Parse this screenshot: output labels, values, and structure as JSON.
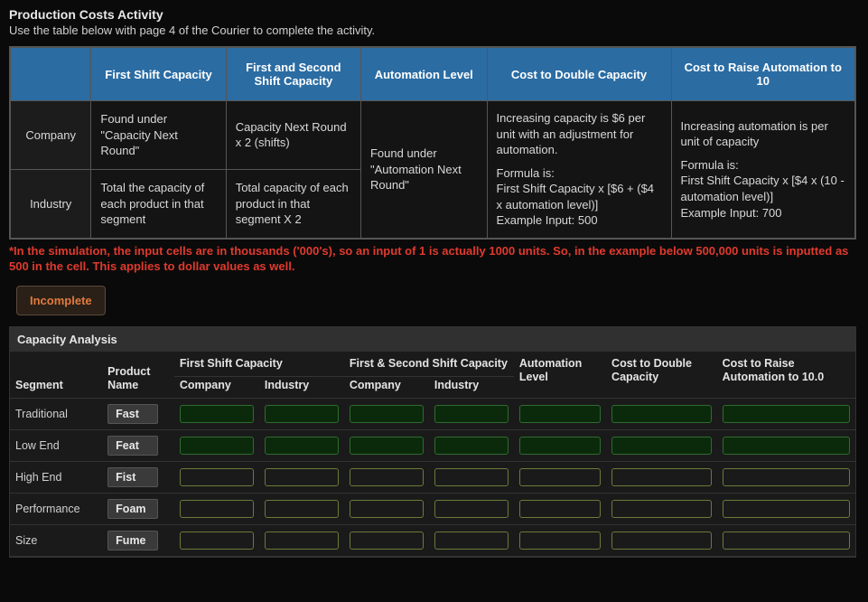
{
  "page": {
    "title": "Production Costs Activity",
    "subtitle": "Use the table below with page 4 of the Courier to complete the activity."
  },
  "refTable": {
    "headers": [
      "First Shift Capacity",
      "First and Second Shift Capacity",
      "Automation Level",
      "Cost to Double Capacity",
      "Cost to Raise Automation to 10"
    ],
    "rowLabels": [
      "Company",
      "Industry"
    ],
    "firstShift": {
      "company": "Found under \"Capacity Next Round\"",
      "industry": "Total the capacity of each product in that segment"
    },
    "secondShift": {
      "company": "Capacity Next Round x 2 (shifts)",
      "industry": "Total capacity of each product in that segment X 2"
    },
    "automation": "Found under \"Automation Next Round\"",
    "doubleCost": {
      "top": "Increasing capacity is $6 per unit with an adjustment for automation.",
      "formulaLabel": "Formula is:",
      "formula": "First Shift Capacity x [$6 + ($4 x automation level)]",
      "example": "Example Input: 500"
    },
    "raiseCost": {
      "top": "Increasing automation is per unit of capacity",
      "formulaLabel": "Formula is:",
      "formula": "First Shift Capacity x [$4 x (10 - automation level)]",
      "example": "Example Input: 700"
    }
  },
  "warning": "*In the simulation, the input cells are in thousands ('000's), so an input of 1 is actually 1000 units. So, in the example below 500,000 units is inputted as 500 in the cell. This applies to dollar values as well.",
  "statusButton": "Incomplete",
  "capacity": {
    "title": "Capacity Analysis",
    "columns": {
      "segment": "Segment",
      "product": "Product Name",
      "firstShift": "First Shift Capacity",
      "secondShift": "First & Second Shift Capacity",
      "automation": "Automation Level",
      "doubleCost": "Cost to Double Capacity",
      "raiseCost": "Cost to Raise Automation to 10.0",
      "company": "Company",
      "industry": "Industry"
    },
    "rows": [
      {
        "segment": "Traditional",
        "product": "Fast",
        "style": "dark"
      },
      {
        "segment": "Low End",
        "product": "Feat",
        "style": "dark"
      },
      {
        "segment": "High End",
        "product": "Fist",
        "style": "outline"
      },
      {
        "segment": "Performance",
        "product": "Foam",
        "style": "outline"
      },
      {
        "segment": "Size",
        "product": "Fume",
        "style": "outline"
      }
    ]
  }
}
